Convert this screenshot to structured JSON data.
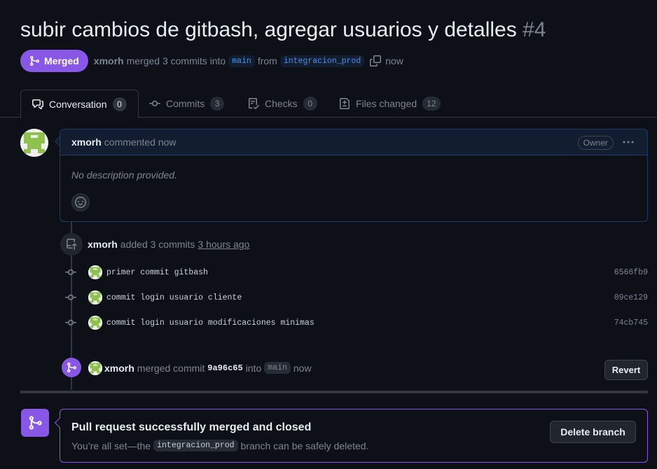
{
  "pr": {
    "title": "subir cambios de gitbash, agregar usuarios y detalles",
    "number": "#4",
    "state_label": "Merged",
    "author": "xmorh",
    "merge_text": "merged 3 commits into",
    "base_branch": "main",
    "from_text": "from",
    "head_branch": "integracion_prod",
    "time": "now"
  },
  "tabs": [
    {
      "label": "Conversation",
      "count": "0",
      "icon": "comment-discussion-icon"
    },
    {
      "label": "Commits",
      "count": "3",
      "icon": "git-commit-icon"
    },
    {
      "label": "Checks",
      "count": "0",
      "icon": "checklist-icon"
    },
    {
      "label": "Files changed",
      "count": "12",
      "icon": "file-diff-icon"
    }
  ],
  "comment": {
    "author": "xmorh",
    "action": "commented now",
    "role_badge": "Owner",
    "body": "No description provided."
  },
  "commits_event": {
    "author": "xmorh",
    "action": "added 3 commits",
    "time": "3 hours ago"
  },
  "commits": [
    {
      "message": "primer commit gitbash",
      "sha": "6566fb9"
    },
    {
      "message": "commit login usuario cliente",
      "sha": "09ce129"
    },
    {
      "message": "commit login usuario modificaciones minimas",
      "sha": "74cb745"
    }
  ],
  "merge_event": {
    "author": "xmorh",
    "action": "merged commit",
    "sha": "9a96c65",
    "into": "into",
    "branch": "main",
    "time": "now",
    "revert_label": "Revert"
  },
  "merged_card": {
    "title": "Pull request successfully merged and closed",
    "sub_prefix": "You’re all set—the",
    "branch": "integracion_prod",
    "sub_suffix": "branch can be safely deleted.",
    "delete_label": "Delete branch"
  },
  "colors": {
    "background": "#0d1117",
    "merged_purple": "#8957e5",
    "link_blue": "#4493f8",
    "avatar_green": "#8fc24d"
  }
}
